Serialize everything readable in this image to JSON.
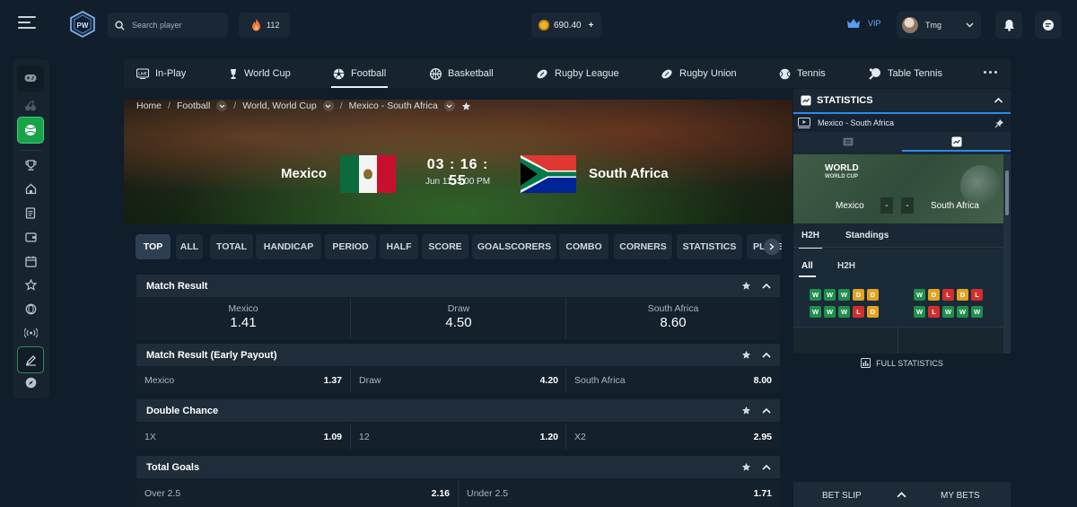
{
  "search": {
    "placeholder": "Search player"
  },
  "rewards": {
    "count": "112"
  },
  "wallet": {
    "balance": "690.40",
    "add_label": "+"
  },
  "vip": {
    "label": "VIP"
  },
  "user": {
    "name": "Tmg"
  },
  "colors": {
    "accent_green": "#18a34a",
    "accent_blue": "#2f89e6",
    "win": "#1f8f4e",
    "draw": "#e2a324",
    "loss": "#d32e2e"
  },
  "sports": [
    {
      "label": "In-Play",
      "icon": "live-tv-icon"
    },
    {
      "label": "World Cup",
      "icon": "trophy-icon"
    },
    {
      "label": "Football",
      "icon": "football-icon"
    },
    {
      "label": "Basketball",
      "icon": "basketball-icon"
    },
    {
      "label": "Rugby League",
      "icon": "rugby-icon"
    },
    {
      "label": "Rugby Union",
      "icon": "rugby-union-icon"
    },
    {
      "label": "Tennis",
      "icon": "tennis-icon"
    },
    {
      "label": "Table Tennis",
      "icon": "table-tennis-icon"
    }
  ],
  "breadcrumb": {
    "home": "Home",
    "sport": "Football",
    "league": "World, World Cup",
    "match": "Mexico - South Africa"
  },
  "match": {
    "home": "Mexico",
    "away": "South Africa",
    "countdown": "03 : 16 : 55",
    "kickoff": "Jun 11, 3:00 PM"
  },
  "market_tabs": [
    "TOP",
    "ALL",
    "TOTAL",
    "HANDICAP",
    "PERIOD",
    "HALF",
    "SCORE",
    "GOALSCORERS",
    "COMBO",
    "CORNERS",
    "STATISTICS",
    "PLAYER"
  ],
  "markets": {
    "match_result": {
      "title": "Match Result",
      "outcomes": [
        {
          "name": "Mexico",
          "odds": "1.41"
        },
        {
          "name": "Draw",
          "odds": "4.50"
        },
        {
          "name": "South Africa",
          "odds": "8.60"
        }
      ]
    },
    "early_payout": {
      "title": "Match Result (Early Payout)",
      "outcomes": [
        {
          "name": "Mexico",
          "odds": "1.37"
        },
        {
          "name": "Draw",
          "odds": "4.20"
        },
        {
          "name": "South Africa",
          "odds": "8.00"
        }
      ]
    },
    "double_chance": {
      "title": "Double Chance",
      "outcomes": [
        {
          "name": "1X",
          "odds": "1.09"
        },
        {
          "name": "12",
          "odds": "1.20"
        },
        {
          "name": "X2",
          "odds": "2.95"
        }
      ]
    },
    "total_goals": {
      "title": "Total Goals",
      "outcomes": [
        {
          "name": "Over 2.5",
          "odds": "2.16"
        },
        {
          "name": "Under 2.5",
          "odds": "1.71"
        }
      ]
    }
  },
  "stats": {
    "title": "STATISTICS",
    "match": "Mexico - South Africa",
    "widget": {
      "title": "WORLD",
      "subtitle": "WORLD CUP",
      "home": "Mexico",
      "away": "South Africa",
      "home_score": "-",
      "away_score": "-",
      "tabs": [
        "H2H",
        "Standings"
      ],
      "subtabs": [
        "All",
        "H2H"
      ],
      "home_form": [
        [
          "W",
          "W",
          "W",
          "D",
          "D"
        ],
        [
          "W",
          "W",
          "W",
          "L",
          "D"
        ]
      ],
      "away_form": [
        [
          "W",
          "D",
          "L",
          "D",
          "L"
        ],
        [
          "W",
          "L",
          "W",
          "W",
          "W"
        ]
      ]
    },
    "full_label": "FULL STATISTICS"
  },
  "betslip": {
    "label": "BET SLIP",
    "mybets": "MY BETS"
  }
}
